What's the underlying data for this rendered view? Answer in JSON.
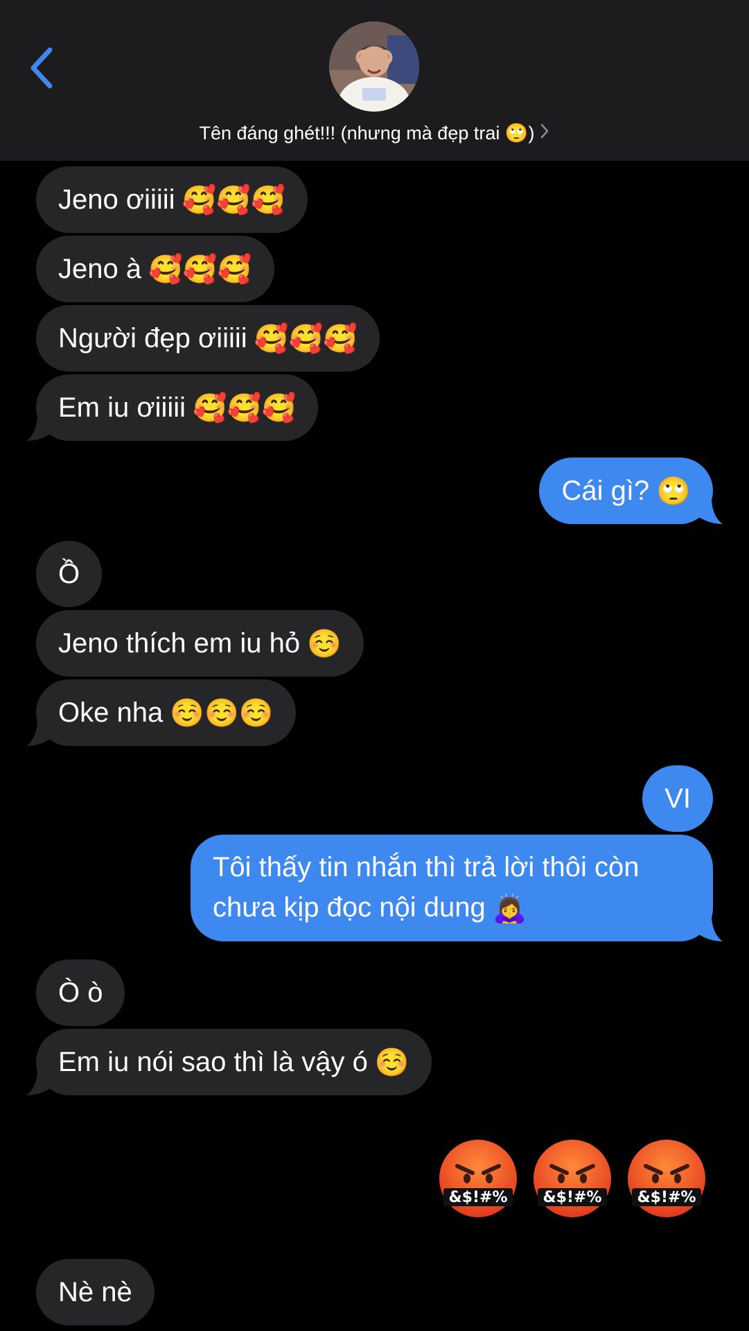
{
  "header": {
    "contact_name": "Tên đáng ghét!!! (nhưng mà đẹp trai 🙄)",
    "chevron": "›",
    "back_icon": "chevron-left-icon",
    "accent_color": "#3d89f0"
  },
  "messages": [
    {
      "dir": "in",
      "text": "Jeno ơiiiii",
      "emoji": "🥰🥰🥰"
    },
    {
      "dir": "in",
      "text": "Jeno à",
      "emoji": "🥰🥰🥰"
    },
    {
      "dir": "in",
      "text": "Người đẹp ơiiiii",
      "emoji": "🥰🥰🥰"
    },
    {
      "dir": "in",
      "text": "Em iu ơiiiii",
      "emoji": "🥰🥰🥰"
    },
    {
      "dir": "out",
      "text": "Cái gì?",
      "emoji": "🙄"
    },
    {
      "dir": "in",
      "text": "Ồ",
      "emoji": ""
    },
    {
      "dir": "in",
      "text": "Jeno thích em iu hỏ",
      "emoji": "☺️"
    },
    {
      "dir": "in",
      "text": "Oke nha",
      "emoji": "☺️☺️☺️"
    },
    {
      "dir": "out",
      "text": "VI",
      "emoji": ""
    },
    {
      "dir": "out",
      "text_line1": "Tôi thấy tin nhắn thì trả lời thôi còn",
      "text_line2": "chưa kịp đọc nội dung",
      "emoji": "🙇‍♀️"
    },
    {
      "dir": "in",
      "text": "Ò ò",
      "emoji": ""
    },
    {
      "dir": "in",
      "text": "Em iu nói sao thì là vậy ó",
      "emoji": "☺️"
    },
    {
      "dir": "out",
      "big_emoji": "🤬🤬🤬",
      "overlay": "&$!#%"
    },
    {
      "dir": "in",
      "text": "Nè nè",
      "emoji": ""
    }
  ]
}
